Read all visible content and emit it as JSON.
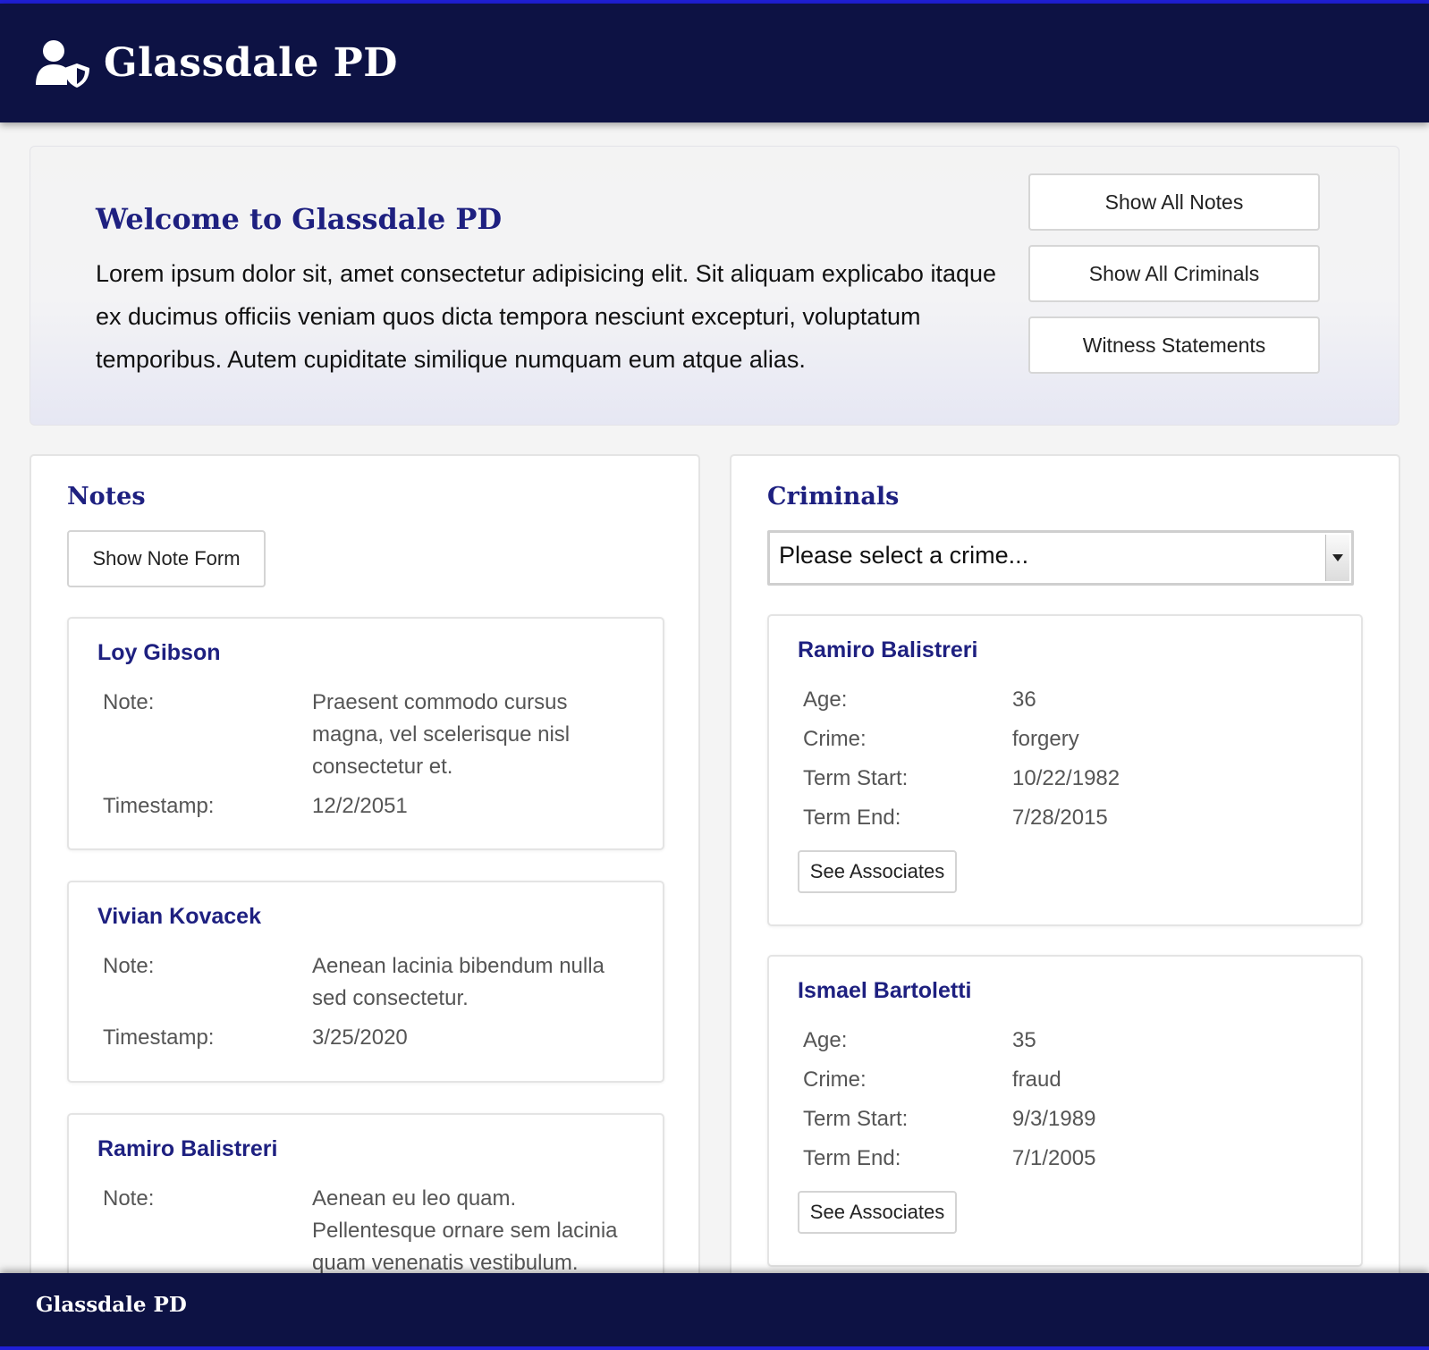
{
  "header": {
    "title": "Glassdale PD",
    "icon": "user-shield-icon"
  },
  "welcome": {
    "title": "Welcome to Glassdale PD",
    "text": "Lorem ipsum dolor sit, amet consectetur adipisicing elit. Sit aliquam explicabo itaque ex ducimus officiis veniam quos dicta tempora nesciunt excepturi, voluptatum temporibus. Autem cupiditate similique numquam eum atque alias.",
    "buttons": [
      "Show All Notes",
      "Show All Criminals",
      "Witness Statements"
    ]
  },
  "notes": {
    "title": "Notes",
    "show_form_label": "Show Note Form",
    "note_label": "Note:",
    "timestamp_label": "Timestamp:",
    "items": [
      {
        "name": "Loy Gibson",
        "note_lines": [
          "Praesent commodo cursus",
          "magna, vel scelerisque nisl",
          "consectetur et."
        ],
        "timestamp": "12/2/2051"
      },
      {
        "name": "Vivian Kovacek",
        "note_lines": [
          "Aenean lacinia bibendum nulla",
          "sed consectetur."
        ],
        "timestamp": "3/25/2020"
      },
      {
        "name": "Ramiro Balistreri",
        "note_lines": [
          "Aenean eu leo quam.",
          "Pellentesque ornare sem lacinia",
          "quam venenatis vestibulum."
        ],
        "timestamp": ""
      }
    ]
  },
  "criminals": {
    "title": "Criminals",
    "select_value": "Please select a crime...",
    "age_label": "Age:",
    "crime_label": "Crime:",
    "term_start_label": "Term Start:",
    "term_end_label": "Term End:",
    "associates_label": "See Associates",
    "items": [
      {
        "name": "Ramiro Balistreri",
        "age": "36",
        "crime": "forgery",
        "term_start": "10/22/1982",
        "term_end": "7/28/2015"
      },
      {
        "name": "Ismael Bartoletti",
        "age": "35",
        "crime": "fraud",
        "term_start": "9/3/1989",
        "term_end": "7/1/2005"
      }
    ]
  },
  "footer": {
    "title": "Glassdale PD"
  },
  "colors": {
    "navy": "#0d1244",
    "heading": "#1e2080",
    "accent_line": "#1f1fd6"
  }
}
